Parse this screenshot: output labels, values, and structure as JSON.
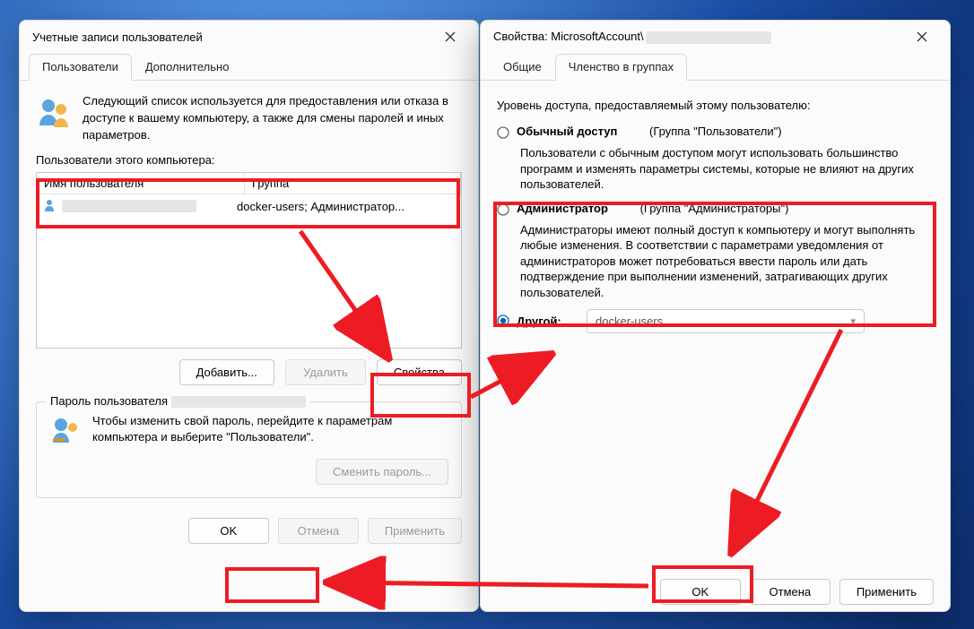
{
  "left": {
    "title": "Учетные записи пользователей",
    "tabs": {
      "users": "Пользователи",
      "advanced": "Дополнительно"
    },
    "intro": "Следующий список используется для предоставления или отказа в доступе к вашему компьютеру, а также для смены паролей и иных параметров.",
    "list_label": "Пользователи этого компьютера:",
    "cols": {
      "name": "Имя пользователя",
      "group": "Группа"
    },
    "row_group": "docker-users; Администратор...",
    "btn_add": "Добавить...",
    "btn_del": "Удалить",
    "btn_props": "Свойства",
    "pw_legend": "Пароль пользователя",
    "pw_text": "Чтобы изменить свой пароль, перейдите к параметрам компьютера и выберите \"Пользователи\".",
    "btn_changepw": "Сменить пароль...",
    "ok": "OK",
    "cancel": "Отмена",
    "apply": "Применить"
  },
  "right": {
    "title_prefix": "Свойства: MicrosoftAccount\\",
    "tabs": {
      "general": "Общие",
      "membership": "Членство в группах"
    },
    "intro": "Уровень доступа, предоставляемый этому пользователю:",
    "opt_standard": {
      "label": "Обычный доступ",
      "group": "(Группа \"Пользователи\")",
      "desc": "Пользователи с обычным доступом могут использовать большинство программ и изменять параметры системы, которые не влияют на других пользователей."
    },
    "opt_admin": {
      "label": "Администратор",
      "group": "(Группа \"Администраторы\")",
      "desc": "Администраторы имеют полный доступ к компьютеру и могут выполнять любые изменения. В соответствии с параметрами уведомления от администраторов может потребоваться ввести пароль или дать подтверждение при выполнении изменений, затрагивающих других пользователей."
    },
    "opt_other": {
      "label": "Другой:",
      "combo_value": "docker-users"
    },
    "ok": "OK",
    "cancel": "Отмена",
    "apply": "Применить"
  }
}
